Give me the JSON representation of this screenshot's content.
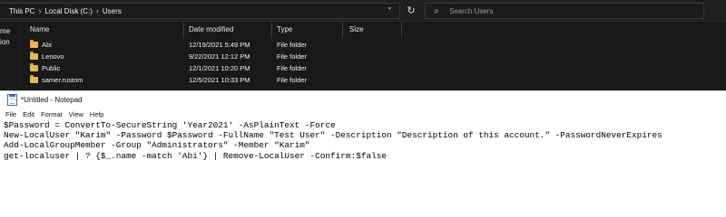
{
  "explorer": {
    "breadcrumb": [
      "This PC",
      "Local Disk (C:)",
      "Users"
    ],
    "search_placeholder": "Search Users",
    "nav_pane_text": [
      "me",
      "ion"
    ],
    "columns": [
      "Name",
      "Date modified",
      "Type",
      "Size"
    ],
    "files": [
      {
        "name": "Abi",
        "date": "12/19/2021 5:49 PM",
        "type": "File folder"
      },
      {
        "name": "Lenovo",
        "date": "9/22/2021 12:12 PM",
        "type": "File folder"
      },
      {
        "name": "Public",
        "date": "12/1/2021 10:20 PM",
        "type": "File folder"
      },
      {
        "name": "samer.rustom",
        "date": "12/5/2021 10:33 PM",
        "type": "File folder"
      }
    ]
  },
  "notepad": {
    "title": "*Untitled - Notepad",
    "menu": [
      "File",
      "Edit",
      "Format",
      "View",
      "Help"
    ],
    "lines": [
      "$Password = ConvertTo-SecureString 'Year2021' -AsPlainText -Force",
      "New-LocalUser \"Karim\" -Password $Password -FullName \"Test User\" -Description \"Description of this account.\" -PasswordNeverExpires",
      "Add-LocalGroupMember -Group \"Administrators\" -Member \"Karim\"",
      "get-localuser | ? {$_.name -match 'Abi'} | Remove-LocalUser -Confirm:$false"
    ]
  }
}
